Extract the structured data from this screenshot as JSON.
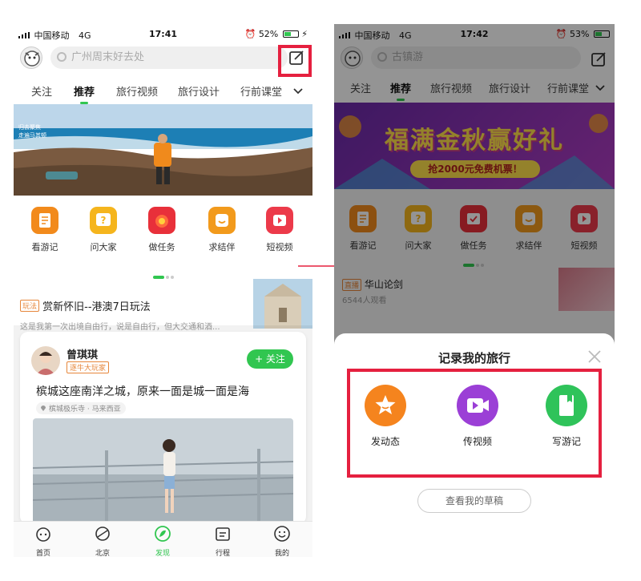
{
  "left": {
    "status": {
      "carrier": "中国移动",
      "network": "4G",
      "time": "17:41",
      "battery": "52%",
      "battery_level": 0.52
    },
    "search_placeholder": "广州周末好去处",
    "tabs": [
      "关注",
      "推荐",
      "旅行视频",
      "旅行设计",
      "行前课堂"
    ],
    "active_tab": "推荐",
    "banner_text": [
      "归去聚焦",
      "走遍马其顿"
    ],
    "categories": [
      {
        "label": "看游记",
        "icon": "notes-icon",
        "color": "#f28a1c"
      },
      {
        "label": "问大家",
        "icon": "question-icon",
        "color": "#f5b51d"
      },
      {
        "label": "做任务",
        "icon": "task-icon",
        "color": "#e8303a"
      },
      {
        "label": "求结伴",
        "icon": "companion-icon",
        "color": "#f29a1c"
      },
      {
        "label": "短视频",
        "icon": "video-icon",
        "color": "#ec3a4a"
      }
    ],
    "feed": {
      "tag": "玩法",
      "title": "赏新怀旧--港澳7日玩法",
      "desc": "这是我第一次出境自由行，说是自由行，但大交通和酒..."
    },
    "card": {
      "author": "曾琪琪",
      "badge": "逐牛大玩家",
      "follow": "+ 关注",
      "title": "槟城这座南洋之城，原来一面是城一面是海",
      "location": "槟城极乐寺 · 马来西亚"
    },
    "bottom_nav": [
      {
        "label": "首页",
        "icon": "home-icon"
      },
      {
        "label": "北京",
        "icon": "city-icon"
      },
      {
        "label": "发现",
        "icon": "discover-icon"
      },
      {
        "label": "行程",
        "icon": "itinerary-icon"
      },
      {
        "label": "我的",
        "icon": "profile-icon"
      }
    ],
    "active_nav": "发现"
  },
  "right": {
    "status": {
      "carrier": "中国移动",
      "network": "4G",
      "time": "17:42",
      "battery": "53%",
      "battery_level": 0.53
    },
    "search_placeholder": "古镇游",
    "tabs": [
      "关注",
      "推荐",
      "旅行视频",
      "旅行设计",
      "行前课堂"
    ],
    "active_tab": "推荐",
    "banner_title": "福满金秋赢好礼",
    "banner_sub": "抢2000元免费机票！",
    "categories": [
      {
        "label": "看游记",
        "icon": "notes-icon",
        "color": "#f28a1c"
      },
      {
        "label": "问大家",
        "icon": "question-icon",
        "color": "#f5b51d"
      },
      {
        "label": "做任务",
        "icon": "task-icon",
        "color": "#e8303a"
      },
      {
        "label": "求结伴",
        "icon": "companion-icon",
        "color": "#f29a1c"
      },
      {
        "label": "短视频",
        "icon": "video-icon",
        "color": "#ec3a4a"
      }
    ],
    "live": {
      "tag": "直播",
      "title": "华山论剑",
      "viewers": "6544人观看"
    },
    "sheet": {
      "title": "记录我的旅行",
      "options": [
        {
          "label": "发动态",
          "icon": "star-icon",
          "color": "#f5841e"
        },
        {
          "label": "传视频",
          "icon": "video-camera-icon",
          "color": "#9b3fd6"
        },
        {
          "label": "写游记",
          "icon": "notebook-icon",
          "color": "#2fc35a"
        }
      ],
      "drafts": "查看我的草稿"
    }
  },
  "colors": {
    "accent": "#31c650",
    "highlight": "#e5203f",
    "tag": "#e6863a"
  }
}
